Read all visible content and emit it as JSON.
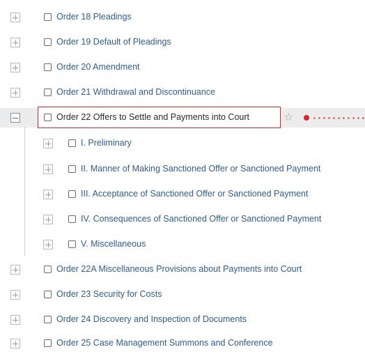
{
  "tree": {
    "items": [
      {
        "label": "Order 18 Pleadings",
        "expander": "plus",
        "level": 0
      },
      {
        "label": "Order 19 Default of Pleadings",
        "expander": "plus",
        "level": 0
      },
      {
        "label": "Order 20 Amendment",
        "expander": "plus",
        "level": 0
      },
      {
        "label": "Order 21 Withdrawal and Discontinuance",
        "expander": "plus",
        "level": 0
      },
      {
        "label": "Order 22 Offers to Settle and Payments into Court",
        "expander": "minus",
        "level": 0,
        "selected": true
      },
      {
        "label": "I. Preliminary",
        "expander": "plus",
        "level": 1
      },
      {
        "label": "II. Manner of Making Sanctioned Offer or Sanctioned Payment",
        "expander": "plus",
        "level": 1
      },
      {
        "label": "III. Acceptance of Sanctioned Offer or Sanctioned Payment",
        "expander": "plus",
        "level": 1
      },
      {
        "label": "IV. Consequences of Sanctioned Offer or Sanctioned Payment",
        "expander": "plus",
        "level": 1
      },
      {
        "label": "V. Miscellaneous",
        "expander": "plus",
        "level": 1
      },
      {
        "label": "Order 22A Miscellaneous Provisions about Payments into Court",
        "expander": "plus",
        "level": 0
      },
      {
        "label": "Order 23 Security for Costs",
        "expander": "plus",
        "level": 0
      },
      {
        "label": "Order 24 Discovery and Inspection of Documents",
        "expander": "plus",
        "level": 0
      },
      {
        "label": "Order 25 Case Management Summons and Conference",
        "expander": "plus",
        "level": 0
      }
    ],
    "star_icon": "star-icon",
    "colors": {
      "link": "#2d5c9a",
      "highlight": "#d8262c"
    }
  }
}
